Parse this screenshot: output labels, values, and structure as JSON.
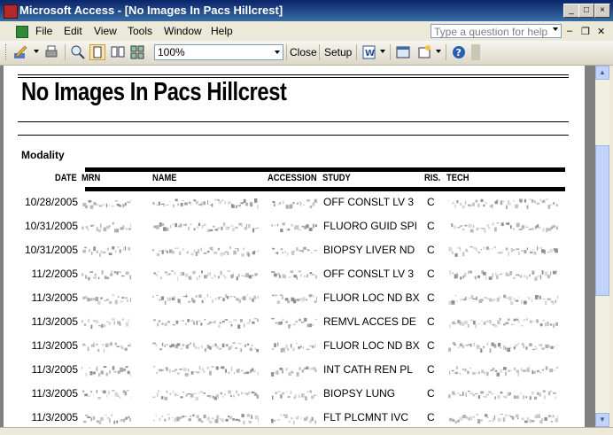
{
  "window": {
    "title": "Microsoft Access - [No Images In Pacs Hillcrest]"
  },
  "menu": {
    "items": [
      "File",
      "Edit",
      "View",
      "Tools",
      "Window",
      "Help"
    ]
  },
  "help": {
    "placeholder": "Type a question for help"
  },
  "toolbar": {
    "zoom": "100%",
    "close_label": "Close",
    "setup_label": "Setup"
  },
  "report": {
    "title": "No Images In Pacs Hillcrest",
    "group_label": "Modality",
    "columns": {
      "date": "DATE",
      "mrn": "MRN",
      "name": "NAME",
      "accession": "ACCESSION",
      "study": "STUDY",
      "ris": "RIS.",
      "tech": "TECH"
    },
    "rows": [
      {
        "date": "10/28/2005",
        "study": "OFF CONSLT LV 3",
        "ris": "C"
      },
      {
        "date": "10/31/2005",
        "study": "FLUORO GUID SPI",
        "ris": "C"
      },
      {
        "date": "10/31/2005",
        "study": "BIOPSY LIVER ND",
        "ris": "C"
      },
      {
        "date": "11/2/2005",
        "study": "OFF CONSLT LV 3",
        "ris": "C"
      },
      {
        "date": "11/3/2005",
        "study": "FLUOR LOC ND BX",
        "ris": "C"
      },
      {
        "date": "11/3/2005",
        "study": "REMVL ACCES DE",
        "ris": "C"
      },
      {
        "date": "11/3/2005",
        "study": "FLUOR LOC ND BX",
        "ris": "C"
      },
      {
        "date": "11/3/2005",
        "study": "INT CATH REN PL",
        "ris": "C"
      },
      {
        "date": "11/3/2005",
        "study": "BIOPSY LUNG",
        "ris": "C"
      },
      {
        "date": "11/3/2005",
        "study": "FLT PLCMNT IVC",
        "ris": "C"
      }
    ]
  }
}
